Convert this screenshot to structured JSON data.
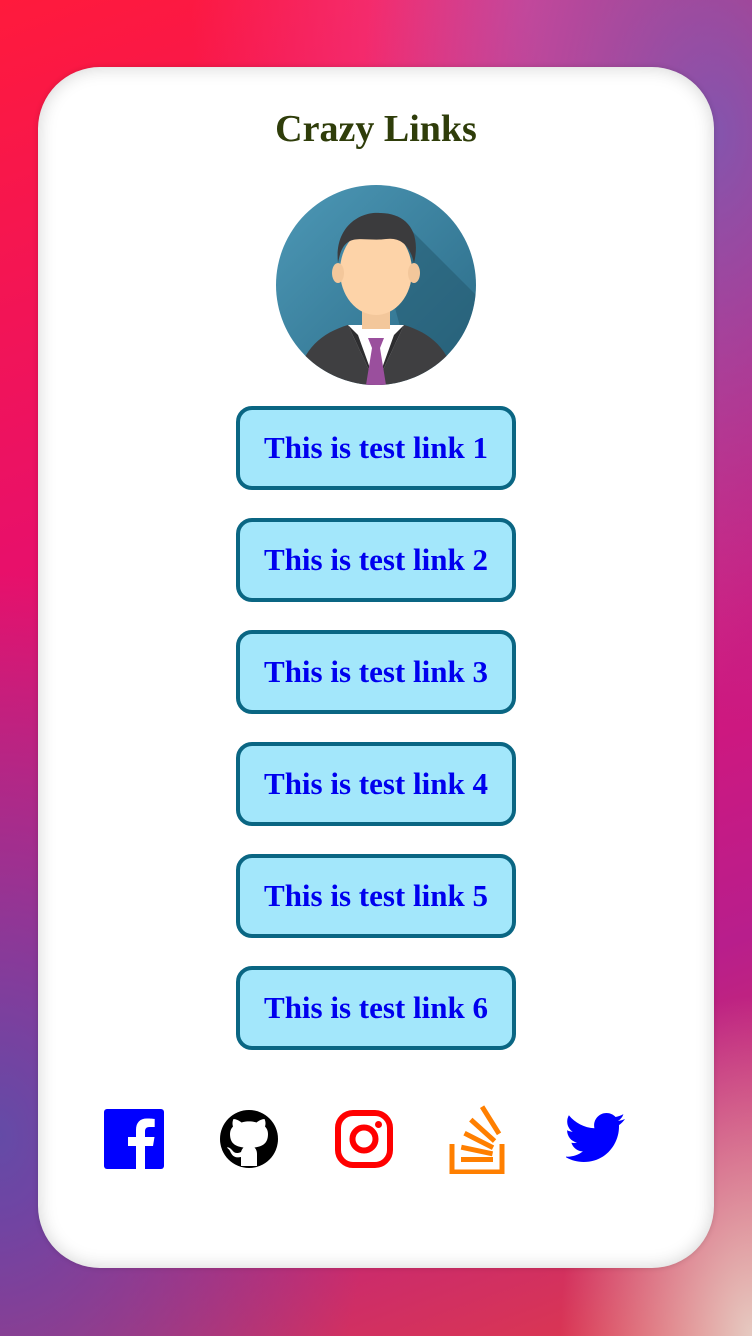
{
  "page": {
    "title": "Crazy Links"
  },
  "avatar": {
    "icon": "person-avatar-icon"
  },
  "links": [
    {
      "label": "This is test link 1"
    },
    {
      "label": "This is test link 2"
    },
    {
      "label": "This is test link 3"
    },
    {
      "label": "This is test link 4"
    },
    {
      "label": "This is test link 5"
    },
    {
      "label": "This is test link 6"
    }
  ],
  "social": [
    {
      "icon": "facebook-icon",
      "color": "#0000ff"
    },
    {
      "icon": "github-icon",
      "color": "#000000"
    },
    {
      "icon": "instagram-icon",
      "color": "#ff0000"
    },
    {
      "icon": "stackoverflow-icon",
      "color": "#ff7f00"
    },
    {
      "icon": "twitter-icon",
      "color": "#0000ff"
    }
  ],
  "colors": {
    "title": "#2f3d0a",
    "link_text": "#0000ee",
    "link_bg": "#a3e7fb",
    "link_border": "#0a6683"
  }
}
